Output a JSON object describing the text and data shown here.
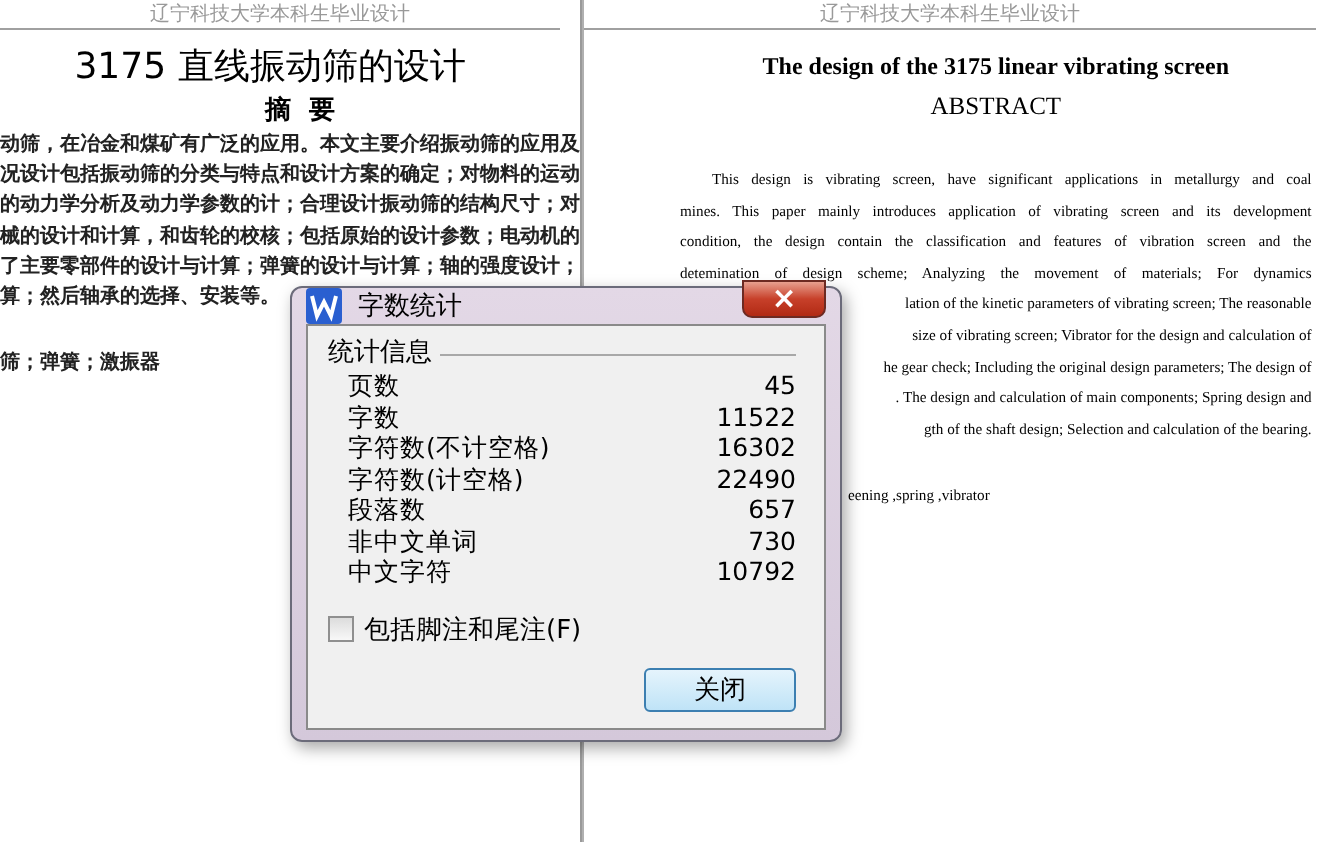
{
  "pages": [
    {
      "header": "辽宁科技大学本科生毕业设计",
      "title": "3175 直线振动筛的设计",
      "heading": "摘  要",
      "lines": [
        {
          "kind": "full",
          "text": "动筛，在冶金和煤矿有广泛的应用。本文主要介绍振动筛的应用及"
        },
        {
          "kind": "full",
          "text": "况设计包括振动筛的分类与特点和设计方案的确定；对物料的运动"
        },
        {
          "kind": "full",
          "text": "的动力学分析及动力学参数的计；合理设计振动筛的结构尺寸；对"
        },
        {
          "kind": "full",
          "text": "械的设计和计算，和齿轮的校核；包括原始的设计参数；电动机的"
        },
        {
          "kind": "full",
          "text": "了主要零部件的设计与计算；弹簧的设计与计算；轴的强度设计；"
        },
        {
          "kind": "last",
          "text": "算；然后轴承的选择、安装等。"
        }
      ],
      "keywords": "筛；弹簧；激振器"
    },
    {
      "header": "辽宁科技大学本科生毕业设计",
      "title": "The design of the 3175 linear vibrating screen",
      "heading": "ABSTRACT",
      "lines": [
        {
          "kind": "first",
          "text": "This design is vibrating screen, have significant applications in metallurgy and coal"
        },
        {
          "kind": "full",
          "text": "mines. This paper mainly introduces application of vibrating screen and its development"
        },
        {
          "kind": "full",
          "text": "condition, the design contain the classification and features of vibration screen and the"
        },
        {
          "kind": "full",
          "text": "detemination of design scheme; Analyzing the movement of materials; For dynamics"
        },
        {
          "kind": "tail",
          "text": "lation of the kinetic parameters of vibrating screen; The reasonable"
        },
        {
          "kind": "tail",
          "text": "size of vibrating screen; Vibrator for the design and calculation of"
        },
        {
          "kind": "tail",
          "text": "he gear check; Including the original design parameters; The design of"
        },
        {
          "kind": "tail",
          "text": ". The design and calculation of main components; Spring design and"
        },
        {
          "kind": "tailend",
          "text": "gth of the shaft design; Selection and calculation of the bearing."
        }
      ],
      "keywords": "eening ,spring ,vibrator"
    }
  ],
  "dialog": {
    "title": "字数统计",
    "close_glyph": "×",
    "group": "统计信息",
    "rows": [
      {
        "label": "页数",
        "value": "45"
      },
      {
        "label": "字数",
        "value": "11522"
      },
      {
        "label": "字符数(不计空格)",
        "value": "16302"
      },
      {
        "label": "字符数(计空格)",
        "value": "22490"
      },
      {
        "label": "段落数",
        "value": "657"
      },
      {
        "label": "非中文单词",
        "value": "730"
      },
      {
        "label": "中文字符",
        "value": "10792"
      }
    ],
    "checkbox": {
      "label": "包括脚注和尾注(F)",
      "checked": false
    },
    "button": "关闭"
  }
}
